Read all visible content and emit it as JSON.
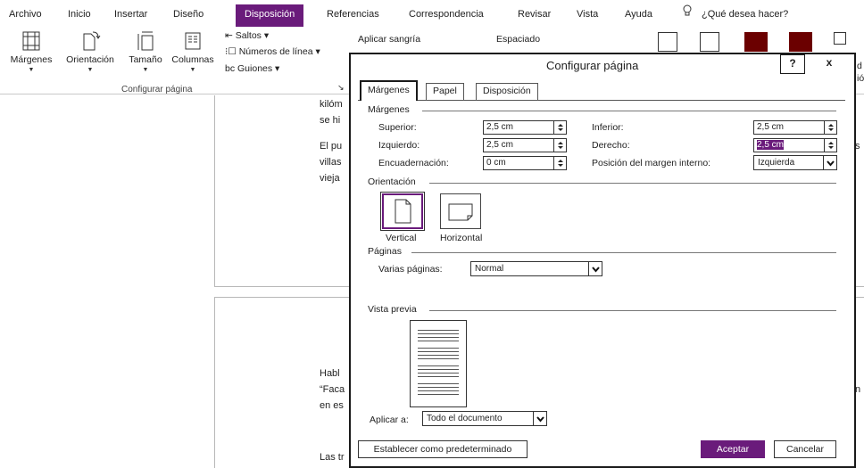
{
  "ribbon": {
    "tabs": [
      "Archivo",
      "Inicio",
      "Insertar",
      "Diseño",
      "Disposición",
      "Referencias",
      "Correspondencia",
      "Revisar",
      "Vista",
      "Ayuda"
    ],
    "active_tab": "Disposición",
    "tell_me": "¿Qué desea hacer?",
    "buttons": {
      "margins": "Márgenes",
      "orientation": "Orientación",
      "size": "Tamaño",
      "columns": "Columnas",
      "breaks": "Saltos",
      "line_numbers": "Números de línea",
      "hyphenation": "Guiones"
    },
    "indent_label": "Aplicar sangría",
    "spacing_label": "Espaciado",
    "group_label": "Configurar página",
    "right_partial": [
      "d",
      "ió"
    ]
  },
  "document": {
    "lines": [
      "kilóm",
      "se hi",
      "El pu",
      "villas",
      "vieja",
      "Habl",
      "“Faca",
      "en es",
      "Las tr"
    ],
    "right_partial": [
      "s",
      "n"
    ]
  },
  "dialog": {
    "title": "Configurar página",
    "help": "?",
    "close": "x",
    "tabs": [
      "Márgenes",
      "Papel",
      "Disposición"
    ],
    "margins_section": "Márgenes",
    "fields": {
      "top_label": "Superior:",
      "top_value": "2,5 cm",
      "bottom_label": "Inferior:",
      "bottom_value": "2,5 cm",
      "left_label": "Izquierdo:",
      "left_value": "2,5 cm",
      "right_label": "Derecho:",
      "right_value": "2,5 cm",
      "gutter_label": "Encuadernación:",
      "gutter_value": "0 cm",
      "gutter_pos_label": "Posición del margen interno:",
      "gutter_pos_value": "Izquierda"
    },
    "orientation_section": "Orientación",
    "orientation_options": [
      "Vertical",
      "Horizontal"
    ],
    "orientation_selected": "Vertical",
    "pages_section": "Páginas",
    "multiple_pages_label": "Varias páginas:",
    "multiple_pages_value": "Normal",
    "preview_section": "Vista previa",
    "apply_to_label": "Aplicar a:",
    "apply_to_value": "Todo el documento",
    "set_default": "Establecer como predeterminado",
    "ok": "Aceptar",
    "cancel": "Cancelar"
  },
  "colors": {
    "accent": "#6a1b7b",
    "dark_red": "#6b0000"
  }
}
